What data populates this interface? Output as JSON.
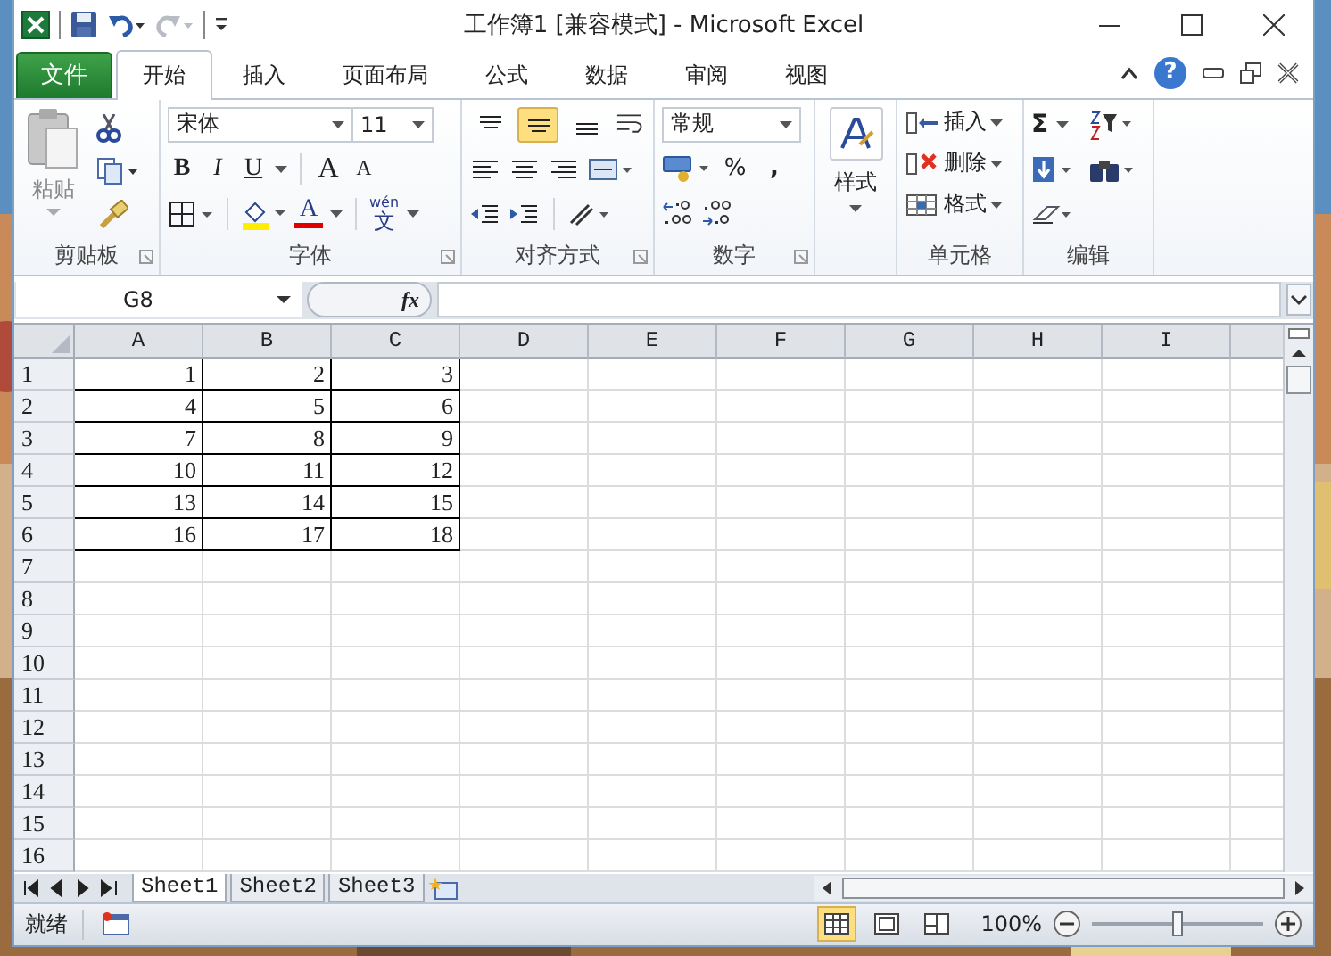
{
  "window": {
    "title": "工作簿1  [兼容模式]  -  Microsoft Excel"
  },
  "tabs": [
    {
      "label": "文件",
      "kind": "file",
      "selected": false
    },
    {
      "label": "开始",
      "kind": "tab",
      "selected": true
    },
    {
      "label": "插入",
      "kind": "tab",
      "selected": false
    },
    {
      "label": "页面布局",
      "kind": "tab",
      "selected": false
    },
    {
      "label": "公式",
      "kind": "tab",
      "selected": false
    },
    {
      "label": "数据",
      "kind": "tab",
      "selected": false
    },
    {
      "label": "审阅",
      "kind": "tab",
      "selected": false
    },
    {
      "label": "视图",
      "kind": "tab",
      "selected": false
    }
  ],
  "help": "?",
  "ribbon": {
    "clipboard": {
      "label": "剪贴板",
      "paste": "粘贴"
    },
    "font": {
      "label": "字体",
      "name": "宋体",
      "size": "11",
      "bold": "B",
      "italic": "I",
      "underline": "U",
      "grow": "A",
      "shrink": "A",
      "color_letter": "A",
      "phonetic_top": "wén",
      "phonetic": "文"
    },
    "alignment": {
      "label": "对齐方式",
      "vertical": [
        {
          "selected": false
        },
        {
          "selected": true
        },
        {
          "selected": false
        }
      ]
    },
    "number": {
      "label": "数字",
      "format": "常规",
      "percent": "%",
      "comma": ","
    },
    "styles": {
      "label": "样式"
    },
    "cells": {
      "label": "单元格",
      "items": [
        {
          "label": "插入",
          "kind": "insert"
        },
        {
          "label": "删除",
          "kind": "delete"
        },
        {
          "label": "格式",
          "kind": "format"
        }
      ]
    },
    "editing": {
      "label": "编辑",
      "sum": "Σ"
    }
  },
  "formula_bar": {
    "name_box": "G8",
    "fx": "fx"
  },
  "columns": [
    "A",
    "B",
    "C",
    "D",
    "E",
    "F",
    "G",
    "H",
    "I"
  ],
  "rows": [
    {
      "header": "1",
      "cells": [
        "1",
        "2",
        "3"
      ]
    },
    {
      "header": "2",
      "cells": [
        "4",
        "5",
        "6"
      ]
    },
    {
      "header": "3",
      "cells": [
        "7",
        "8",
        "9"
      ]
    },
    {
      "header": "4",
      "cells": [
        "10",
        "11",
        "12"
      ]
    },
    {
      "header": "5",
      "cells": [
        "13",
        "14",
        "15"
      ]
    },
    {
      "header": "6",
      "cells": [
        "16",
        "17",
        "18"
      ]
    },
    {
      "header": "7"
    },
    {
      "header": "8"
    },
    {
      "header": "9"
    },
    {
      "header": "10"
    },
    {
      "header": "11"
    },
    {
      "header": "12"
    },
    {
      "header": "13"
    },
    {
      "header": "14"
    },
    {
      "header": "15"
    },
    {
      "header": "16"
    }
  ],
  "sheets": [
    {
      "label": "Sheet1",
      "selected": true
    },
    {
      "label": "Sheet2",
      "selected": false
    },
    {
      "label": "Sheet3",
      "selected": false
    }
  ],
  "status_bar": {
    "status": "就绪",
    "views": [
      {
        "kind": "normal",
        "selected": true
      },
      {
        "kind": "layout",
        "selected": false
      },
      {
        "kind": "break",
        "selected": false
      }
    ],
    "zoom": "100%",
    "level": 0.5
  }
}
